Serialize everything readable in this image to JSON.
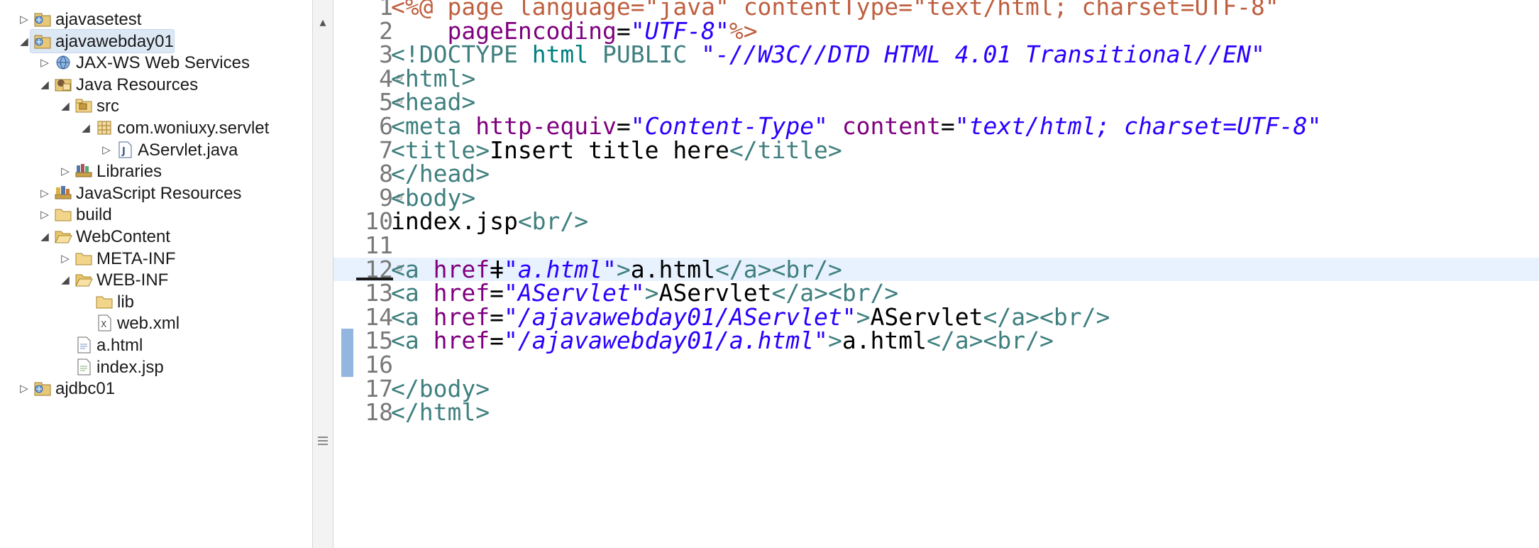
{
  "explorer": {
    "items": [
      {
        "label": "ajavasetest",
        "depth": 0,
        "twisty": "collapsed",
        "icon": "project-icon"
      },
      {
        "label": "ajavawebday01",
        "depth": 0,
        "twisty": "expanded",
        "icon": "project-icon",
        "selected": true
      },
      {
        "label": "JAX-WS Web Services",
        "depth": 1,
        "twisty": "collapsed",
        "icon": "webservices-icon"
      },
      {
        "label": "Java Resources",
        "depth": 1,
        "twisty": "expanded",
        "icon": "java-resources-icon"
      },
      {
        "label": "src",
        "depth": 2,
        "twisty": "expanded",
        "icon": "source-folder-icon"
      },
      {
        "label": "com.woniuxy.servlet",
        "depth": 3,
        "twisty": "expanded",
        "icon": "package-icon"
      },
      {
        "label": "AServlet.java",
        "depth": 4,
        "twisty": "collapsed",
        "icon": "java-file-icon"
      },
      {
        "label": "Libraries",
        "depth": 2,
        "twisty": "collapsed",
        "icon": "libraries-icon"
      },
      {
        "label": "JavaScript Resources",
        "depth": 1,
        "twisty": "collapsed",
        "icon": "javascript-resources-icon"
      },
      {
        "label": "build",
        "depth": 1,
        "twisty": "collapsed",
        "icon": "folder-icon"
      },
      {
        "label": "WebContent",
        "depth": 1,
        "twisty": "expanded",
        "icon": "folder-open-icon"
      },
      {
        "label": "META-INF",
        "depth": 2,
        "twisty": "collapsed",
        "icon": "folder-icon"
      },
      {
        "label": "WEB-INF",
        "depth": 2,
        "twisty": "expanded",
        "icon": "folder-open-icon"
      },
      {
        "label": "lib",
        "depth": 3,
        "twisty": "none",
        "icon": "folder-icon"
      },
      {
        "label": "web.xml",
        "depth": 3,
        "twisty": "none",
        "icon": "xml-file-icon"
      },
      {
        "label": "a.html",
        "depth": 2,
        "twisty": "none",
        "icon": "html-file-icon"
      },
      {
        "label": "index.jsp",
        "depth": 2,
        "twisty": "none",
        "icon": "jsp-file-icon"
      },
      {
        "label": "ajdbc01",
        "depth": 0,
        "twisty": "collapsed",
        "icon": "project-icon"
      }
    ]
  },
  "editor": {
    "lines": [
      {
        "n": "1",
        "fold": false,
        "tokens": [
          [
            "pi",
            "<%@ page language=\"java\" contentType=\"text/html; charset=UTF-8\""
          ]
        ]
      },
      {
        "n": "2",
        "fold": false,
        "tokens": [
          [
            "plain",
            "    "
          ],
          [
            "attr",
            "pageEncoding"
          ],
          [
            "plain",
            "="
          ],
          [
            "str",
            "\"UTF-8\""
          ],
          [
            "pi",
            "%>"
          ]
        ]
      },
      {
        "n": "3",
        "fold": false,
        "tokens": [
          [
            "tag",
            "<!DOCTYPE "
          ],
          [
            "kw",
            "html"
          ],
          [
            "plain",
            " "
          ],
          [
            "dtd",
            "PUBLIC "
          ],
          [
            "str",
            "\"-//W3C//DTD HTML 4.01 Transitional//EN\""
          ]
        ]
      },
      {
        "n": "4",
        "fold": true,
        "tokens": [
          [
            "tag",
            "<html>"
          ]
        ]
      },
      {
        "n": "5",
        "fold": true,
        "tokens": [
          [
            "tag",
            "<head>"
          ]
        ]
      },
      {
        "n": "6",
        "fold": false,
        "tokens": [
          [
            "tag",
            "<meta "
          ],
          [
            "attr",
            "http-equiv"
          ],
          [
            "plain",
            "="
          ],
          [
            "str",
            "\"Content-Type\""
          ],
          [
            "plain",
            " "
          ],
          [
            "attr",
            "content"
          ],
          [
            "plain",
            "="
          ],
          [
            "str",
            "\"text/html; charset=UTF-8\""
          ]
        ]
      },
      {
        "n": "7",
        "fold": false,
        "tokens": [
          [
            "tag",
            "<title>"
          ],
          [
            "plain",
            "Insert title here"
          ],
          [
            "tag",
            "</title>"
          ]
        ]
      },
      {
        "n": "8",
        "fold": false,
        "tokens": [
          [
            "tag",
            "</head>"
          ]
        ]
      },
      {
        "n": "9",
        "fold": true,
        "tokens": [
          [
            "tag",
            "<body>"
          ]
        ]
      },
      {
        "n": "10",
        "fold": false,
        "tokens": [
          [
            "plain",
            "index.jsp"
          ],
          [
            "tag",
            "<br/>"
          ]
        ]
      },
      {
        "n": "11",
        "fold": false,
        "tokens": []
      },
      {
        "n": "12",
        "fold": true,
        "current": true,
        "tokens": [
          [
            "tag",
            "<a "
          ],
          [
            "attr",
            "href"
          ],
          [
            "plain",
            "="
          ],
          [
            "str",
            "\"a.html\""
          ],
          [
            "tag",
            ">"
          ],
          [
            "plain",
            "a.html"
          ],
          [
            "tag",
            "</a><br/>"
          ]
        ]
      },
      {
        "n": "13",
        "fold": false,
        "tokens": [
          [
            "tag",
            "<a "
          ],
          [
            "attr",
            "href"
          ],
          [
            "plain",
            "="
          ],
          [
            "str",
            "\"AServlet\""
          ],
          [
            "tag",
            ">"
          ],
          [
            "plain",
            "AServlet"
          ],
          [
            "tag",
            "</a><br/>"
          ]
        ]
      },
      {
        "n": "14",
        "fold": false,
        "tokens": [
          [
            "tag",
            "<a "
          ],
          [
            "attr",
            "href"
          ],
          [
            "plain",
            "="
          ],
          [
            "str",
            "\"/ajavawebday01/AServlet\""
          ],
          [
            "tag",
            ">"
          ],
          [
            "plain",
            "AServlet"
          ],
          [
            "tag",
            "</a><br/>"
          ]
        ]
      },
      {
        "n": "15",
        "fold": false,
        "tokens": [
          [
            "tag",
            "<a "
          ],
          [
            "attr",
            "href"
          ],
          [
            "plain",
            "="
          ],
          [
            "str",
            "\"/ajavawebday01/a.html\""
          ],
          [
            "tag",
            ">"
          ],
          [
            "plain",
            "a.html"
          ],
          [
            "tag",
            "</a><br/>"
          ]
        ]
      },
      {
        "n": "16",
        "fold": false,
        "tokens": []
      },
      {
        "n": "17",
        "fold": false,
        "tokens": [
          [
            "tag",
            "</body>"
          ]
        ]
      },
      {
        "n": "18",
        "fold": false,
        "tokens": [
          [
            "tag",
            "</html>"
          ]
        ]
      }
    ]
  }
}
